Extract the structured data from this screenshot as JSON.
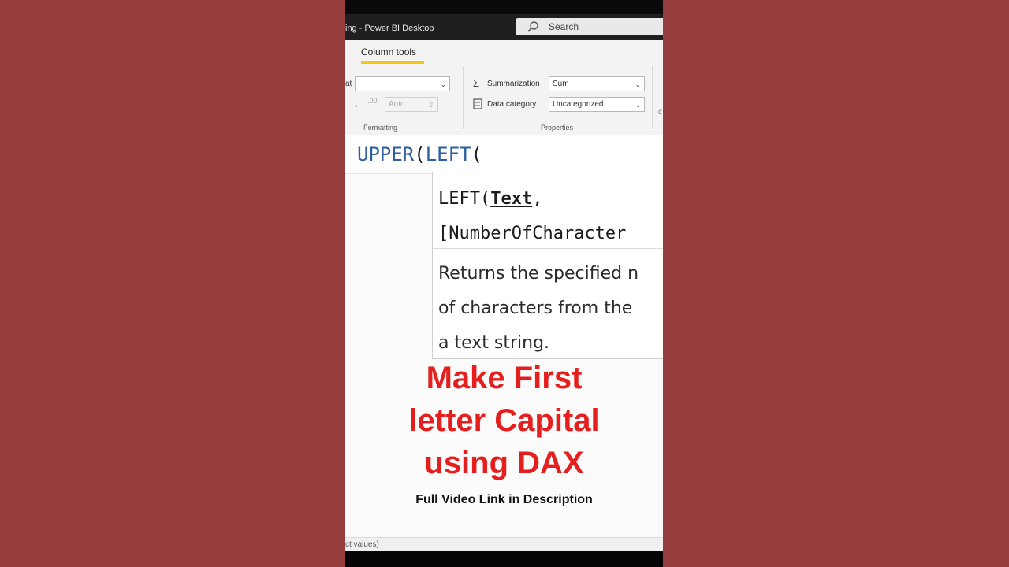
{
  "window": {
    "title": "ing - Power BI Desktop"
  },
  "search": {
    "label": "Search"
  },
  "ribbon": {
    "active_tab": "Column tools",
    "format": {
      "label_fragment": "at",
      "value": ""
    },
    "auto_field": {
      "value": "Auto"
    },
    "formatting_label": "Formatting",
    "summarization": {
      "label": "Summarization",
      "value": "Sum"
    },
    "data_category": {
      "label": "Data category",
      "value": "Uncategorized"
    },
    "properties_label": "Properties",
    "right_fragment": "c"
  },
  "formula_bar": {
    "fn1": "UPPER",
    "paren1": "(",
    "fn2": "LEFT",
    "paren2": "("
  },
  "tooltip": {
    "sig_fn": "LEFT(",
    "sig_param": "Text",
    "sig_comma": ",",
    "sig_line2": "[NumberOfCharacter",
    "desc_lines": [
      "Returns the specified n",
      "of characters from the",
      "a text string."
    ]
  },
  "overlay": {
    "headline_lines": [
      "Make First",
      "letter Capital",
      "using DAX"
    ],
    "subline": "Full Video Link in Description"
  },
  "status": {
    "text": "ct values)"
  },
  "colors": {
    "background": "#963c3c",
    "headline": "#e51e1e",
    "dax_function": "#2f5f9e",
    "tab_accent": "#f2c811"
  }
}
